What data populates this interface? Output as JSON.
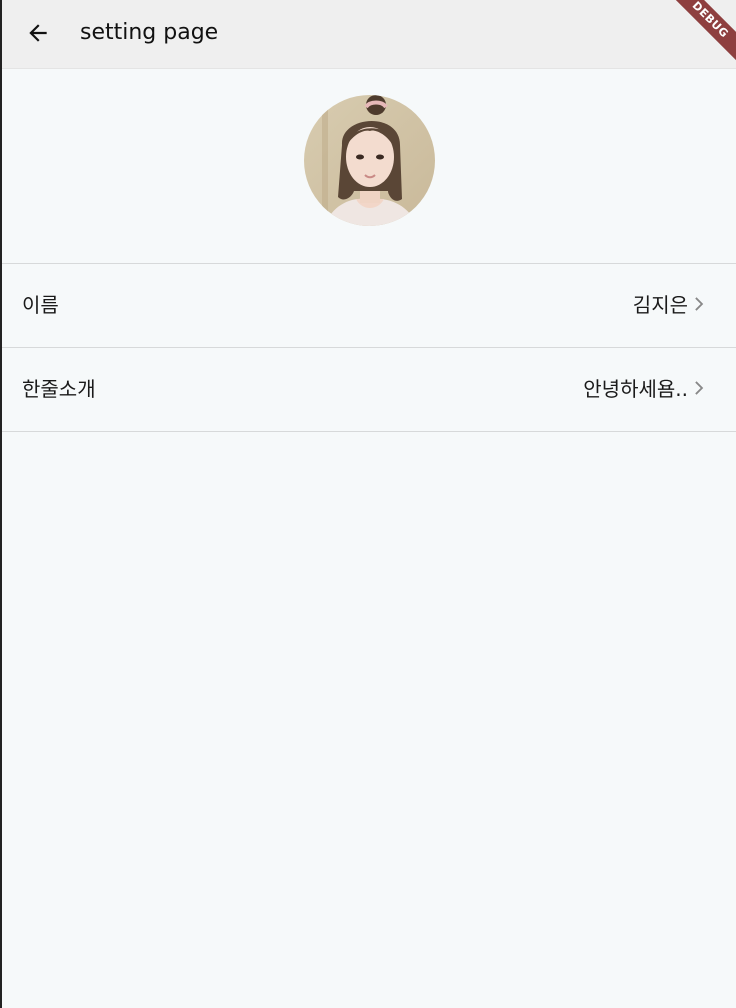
{
  "app_bar": {
    "title": "setting page",
    "back_icon": "arrow-back-icon"
  },
  "debug_banner": {
    "label": "DEBUG",
    "color": "#8e3f3f"
  },
  "profile": {
    "avatar_icon": "profile-photo"
  },
  "settings": {
    "rows": [
      {
        "label": "이름",
        "value": "김지은",
        "icon": "chevron-right-icon"
      },
      {
        "label": "한줄소개",
        "value": "안녕하세욤..",
        "icon": "chevron-right-icon"
      }
    ]
  },
  "colors": {
    "app_bar_bg": "#efefef",
    "page_bg": "#f6f9fa",
    "divider": "#d7d9da",
    "chevron": "#888888"
  }
}
